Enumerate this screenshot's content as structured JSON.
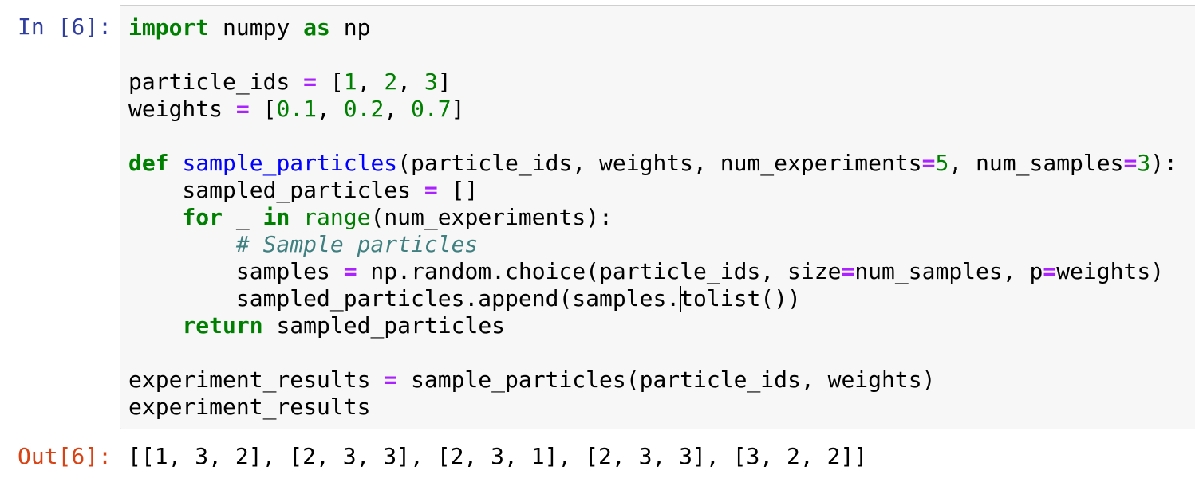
{
  "cell": {
    "input_prompt": "In [6]:",
    "output_prompt": "Out[6]:",
    "code_lines": [
      [
        {
          "t": "kw",
          "v": "import"
        },
        {
          "t": "",
          "v": " numpy "
        },
        {
          "t": "kw",
          "v": "as"
        },
        {
          "t": "",
          "v": " np"
        }
      ],
      [],
      [
        {
          "t": "",
          "v": "particle_ids "
        },
        {
          "t": "op",
          "v": "="
        },
        {
          "t": "",
          "v": " ["
        },
        {
          "t": "num",
          "v": "1"
        },
        {
          "t": "",
          "v": ", "
        },
        {
          "t": "num",
          "v": "2"
        },
        {
          "t": "",
          "v": ", "
        },
        {
          "t": "num",
          "v": "3"
        },
        {
          "t": "",
          "v": "]"
        }
      ],
      [
        {
          "t": "",
          "v": "weights "
        },
        {
          "t": "op",
          "v": "="
        },
        {
          "t": "",
          "v": " ["
        },
        {
          "t": "num",
          "v": "0.1"
        },
        {
          "t": "",
          "v": ", "
        },
        {
          "t": "num",
          "v": "0.2"
        },
        {
          "t": "",
          "v": ", "
        },
        {
          "t": "num",
          "v": "0.7"
        },
        {
          "t": "",
          "v": "]"
        }
      ],
      [],
      [
        {
          "t": "kw",
          "v": "def"
        },
        {
          "t": "",
          "v": " "
        },
        {
          "t": "fn",
          "v": "sample_particles"
        },
        {
          "t": "",
          "v": "(particle_ids, weights, num_experiments"
        },
        {
          "t": "op",
          "v": "="
        },
        {
          "t": "num",
          "v": "5"
        },
        {
          "t": "",
          "v": ", num_samples"
        },
        {
          "t": "op",
          "v": "="
        },
        {
          "t": "num",
          "v": "3"
        },
        {
          "t": "",
          "v": "):"
        }
      ],
      [
        {
          "t": "",
          "v": "    sampled_particles "
        },
        {
          "t": "op",
          "v": "="
        },
        {
          "t": "",
          "v": " []"
        }
      ],
      [
        {
          "t": "",
          "v": "    "
        },
        {
          "t": "kw",
          "v": "for"
        },
        {
          "t": "",
          "v": " _ "
        },
        {
          "t": "kw",
          "v": "in"
        },
        {
          "t": "",
          "v": " "
        },
        {
          "t": "bi",
          "v": "range"
        },
        {
          "t": "",
          "v": "(num_experiments):"
        }
      ],
      [
        {
          "t": "",
          "v": "        "
        },
        {
          "t": "cm",
          "v": "# Sample particles"
        }
      ],
      [
        {
          "t": "",
          "v": "        samples "
        },
        {
          "t": "op",
          "v": "="
        },
        {
          "t": "",
          "v": " np.random.choice(particle_ids, size"
        },
        {
          "t": "op",
          "v": "="
        },
        {
          "t": "",
          "v": "num_samples, p"
        },
        {
          "t": "op",
          "v": "="
        },
        {
          "t": "",
          "v": "weights)"
        }
      ],
      [
        {
          "t": "",
          "v": "        sampled_particles.append(samples."
        },
        {
          "t": "cursor",
          "v": ""
        },
        {
          "t": "",
          "v": "tolist())"
        }
      ],
      [
        {
          "t": "",
          "v": "    "
        },
        {
          "t": "kw",
          "v": "return"
        },
        {
          "t": "",
          "v": " sampled_particles"
        }
      ],
      [],
      [
        {
          "t": "",
          "v": "experiment_results "
        },
        {
          "t": "op",
          "v": "="
        },
        {
          "t": "",
          "v": " sample_particles(particle_ids, weights)"
        }
      ],
      [
        {
          "t": "",
          "v": "experiment_results"
        }
      ]
    ],
    "output_text": "[[1, 3, 2], [2, 3, 3], [2, 3, 1], [2, 3, 3], [3, 2, 2]]"
  },
  "colors": {
    "input_prompt": "#303f9f",
    "output_prompt": "#d84315",
    "keyword": "#008000",
    "operator": "#aa22ff",
    "number": "#008000",
    "function_name": "#0000ff",
    "comment": "#408080",
    "cell_background": "#f7f7f7",
    "cell_border": "#cfcfcf"
  }
}
